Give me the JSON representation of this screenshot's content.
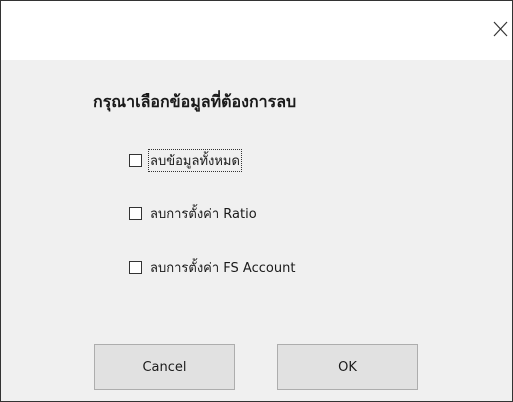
{
  "window": {
    "close_icon": "close-icon"
  },
  "dialog": {
    "heading": "กรุณาเลือกข้อมูลที่ต้องการลบ",
    "options": [
      {
        "label": "ลบข้อมูลทั้งหมด",
        "checked": false,
        "focused": true
      },
      {
        "label": "ลบการตั้งค่า Ratio",
        "checked": false,
        "focused": false
      },
      {
        "label": "ลบการตั้งค่า FS Account",
        "checked": false,
        "focused": false
      }
    ],
    "buttons": {
      "cancel_label": "Cancel",
      "ok_label": "OK"
    }
  },
  "colors": {
    "client_background": "#f0f0f0",
    "button_face": "#e1e1e1",
    "button_border": "#adadad"
  }
}
